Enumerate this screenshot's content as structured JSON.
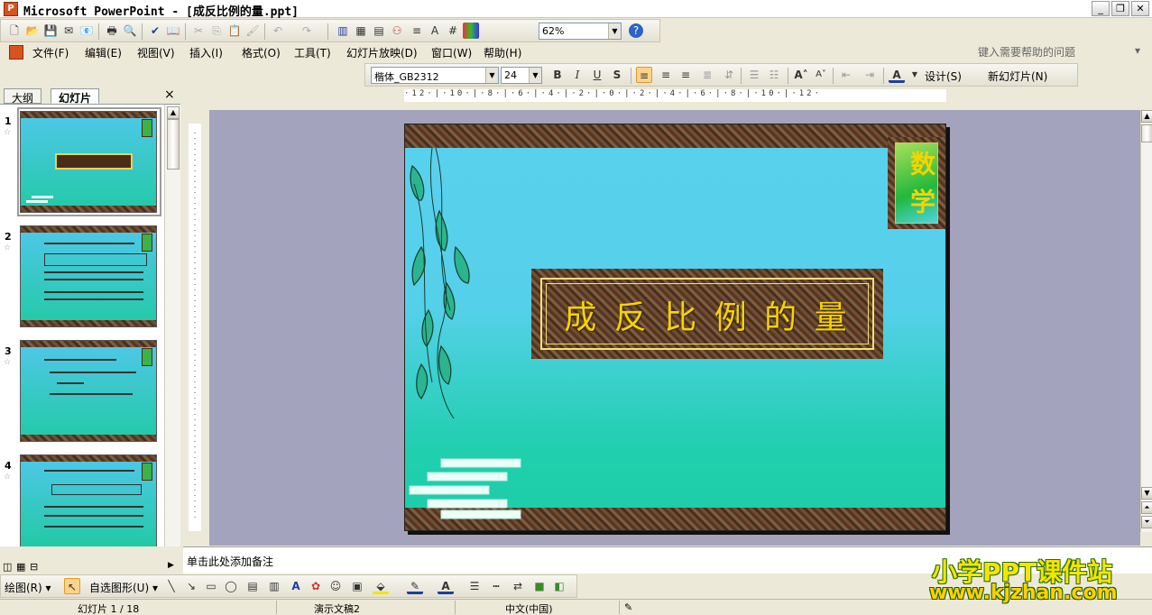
{
  "window": {
    "app_icon_letter": "P",
    "title": "Microsoft PowerPoint - [成反比例的量.ppt]",
    "minimize": "_",
    "restore": "❐",
    "close": "✕"
  },
  "standard_toolbar": {
    "zoom": "62%"
  },
  "menu": {
    "items": [
      "文件(F)",
      "编辑(E)",
      "视图(V)",
      "插入(I)",
      "格式(O)",
      "工具(T)",
      "幻灯片放映(D)",
      "窗口(W)",
      "帮助(H)"
    ],
    "help_placeholder": "键入需要帮助的问题"
  },
  "format_toolbar": {
    "font": "楷体_GB2312",
    "size": "24",
    "bold": "B",
    "italic": "I",
    "underline": "U",
    "shadow": "S",
    "design": "设计(S)",
    "new_slide": "新幻灯片(N)"
  },
  "panel": {
    "tabs": [
      "大纲",
      "幻灯片"
    ],
    "close": "×",
    "slide_numbers": [
      "1",
      "2",
      "3",
      "4"
    ]
  },
  "ruler": {
    "top": "·12·|·10·|·8·|·6·|·4·|·2·|·0·|·2·|·4·|·6·|·8·|·10·|·12·"
  },
  "slide": {
    "title": "成 反 比 例 的 量",
    "badge": "数 学"
  },
  "notes": {
    "placeholder": "单击此处添加备注"
  },
  "draw_toolbar": {
    "draw": "绘图(R)",
    "autoshapes": "自选图形(U)"
  },
  "status": {
    "slide": "幻灯片 1 / 18",
    "design": "演示文稿2",
    "language": "中文(中国)"
  },
  "watermark": {
    "line1": "小学PPT课件站",
    "line2": "www.kjzhan.com"
  },
  "colors": {
    "slide_top": "#59d1ee",
    "slide_bottom": "#1dcea8",
    "title_text": "#f5d400",
    "frame": "#5a3b24"
  }
}
